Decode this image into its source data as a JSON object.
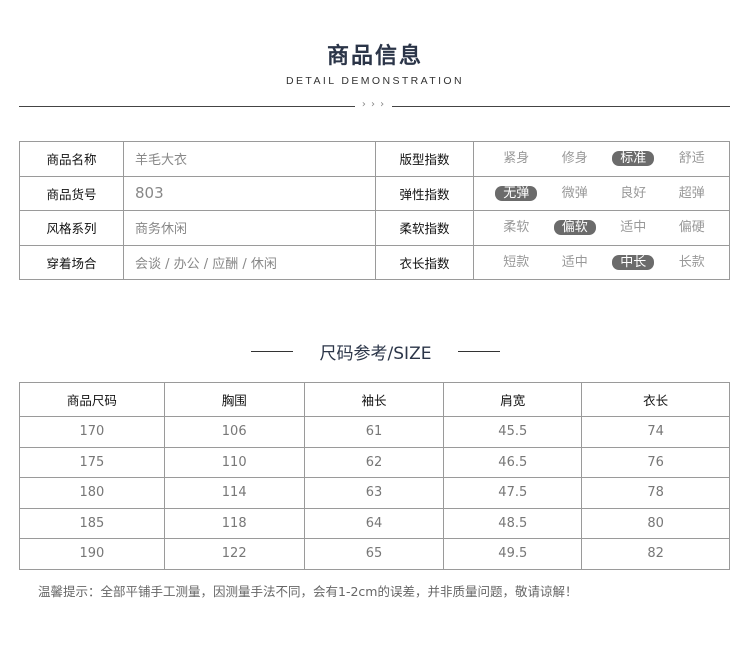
{
  "header": {
    "title": "商品信息",
    "subtitle": "DETAIL DEMONSTRATION",
    "divider_arrows": "› › ›"
  },
  "info": {
    "rows": [
      {
        "label": "商品名称",
        "value": "羊毛大衣",
        "scale_label": "版型指数",
        "options": [
          "紧身",
          "修身",
          "标准",
          "舒适"
        ],
        "selected": 2
      },
      {
        "label": "商品货号",
        "value": "803",
        "scale_label": "弹性指数",
        "options": [
          "无弹",
          "微弹",
          "良好",
          "超弹"
        ],
        "selected": 0
      },
      {
        "label": "风格系列",
        "value": "商务休闲",
        "scale_label": "柔软指数",
        "options": [
          "柔软",
          "偏软",
          "适中",
          "偏硬"
        ],
        "selected": 1
      },
      {
        "label": "穿着场合",
        "value": "会谈 / 办公 / 应酬 / 休闲",
        "scale_label": "衣长指数",
        "options": [
          "短款",
          "适中",
          "中长",
          "长款"
        ],
        "selected": 2
      }
    ]
  },
  "size": {
    "title": "尺码参考/SIZE",
    "headers": [
      "商品尺码",
      "胸围",
      "袖长",
      "肩宽",
      "衣长"
    ],
    "rows": [
      [
        "170",
        "106",
        "61",
        "45.5",
        "74"
      ],
      [
        "175",
        "110",
        "62",
        "46.5",
        "76"
      ],
      [
        "180",
        "114",
        "63",
        "47.5",
        "78"
      ],
      [
        "185",
        "118",
        "64",
        "48.5",
        "80"
      ],
      [
        "190",
        "122",
        "65",
        "49.5",
        "82"
      ]
    ]
  },
  "note": "温馨提示：全部平铺手工测量，因测量手法不同，会有1-2cm的误差，并非质量问题，敬请谅解！",
  "colors": {
    "selected_badge": "#6b6b6b",
    "title": "#2b3548"
  }
}
